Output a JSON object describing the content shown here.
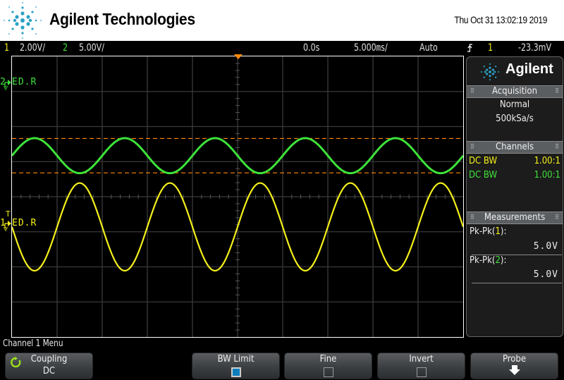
{
  "header": {
    "brand": "Agilent Technologies",
    "datetime": "Thu Oct 31 13:02:19 2019"
  },
  "status": {
    "ch1_num": "1",
    "ch1_scale": "2.00V/",
    "ch2_num": "2",
    "ch2_scale": "5.00V/",
    "time_offset": "0.0s",
    "time_scale": "5.000㎳/",
    "trigger_mode": "Auto",
    "trigger_slope_icon": "rising-edge-icon",
    "trigger_source": "1",
    "trigger_level": "-23.3mV"
  },
  "screen": {
    "colors": {
      "ch1": "#f5f01a",
      "ch2": "#3ee23a",
      "cursor": "#ff8a00",
      "grid": "#3a3a3a"
    },
    "ch1_marker": {
      "num": "1",
      "label": "ED.R",
      "trigger_tag": "T"
    },
    "ch2_marker": {
      "num": "2",
      "label": "ED.R"
    },
    "divisions": {
      "horizontal": 10,
      "vertical": 8
    },
    "waveforms": [
      {
        "channel": 1,
        "volts_per_div": 2.0,
        "pk_pk_v": 5.0,
        "offset_div": -0.86,
        "period_div": 2.0,
        "phase_peak_div": 1.5
      },
      {
        "channel": 2,
        "volts_per_div": 5.0,
        "pk_pk_v": 5.0,
        "offset_div": 1.17,
        "period_div": 2.0,
        "phase_peak_div": 0.5
      }
    ],
    "cursors_div": [
      1.66,
      0.68
    ]
  },
  "sidepanel": {
    "brand": "Agilent",
    "acquisition": {
      "title": "Acquisition",
      "mode": "Normal",
      "rate": "500kSa/s"
    },
    "channels": {
      "title": "Channels",
      "rows": [
        {
          "coupling": "DC BW",
          "ratio": "1.00:1"
        },
        {
          "coupling": "DC BW",
          "ratio": "1.00:1"
        }
      ]
    },
    "measurements": {
      "title": "Measurements",
      "items": [
        {
          "prefix": "Pk-Pk(",
          "ch": "1",
          "suffix": "):",
          "value": "5.0V"
        },
        {
          "prefix": "Pk-Pk(",
          "ch": "2",
          "suffix": "):",
          "value": "5.0V"
        }
      ]
    }
  },
  "menu": {
    "title": "Channel 1 Menu",
    "softkeys": [
      {
        "label": "Coupling",
        "value": "DC"
      },
      {
        "label": "BW Limit",
        "checked": true
      },
      {
        "label": "Fine",
        "checked": false
      },
      {
        "label": "Invert",
        "checked": false
      },
      {
        "label": "Probe"
      }
    ]
  }
}
